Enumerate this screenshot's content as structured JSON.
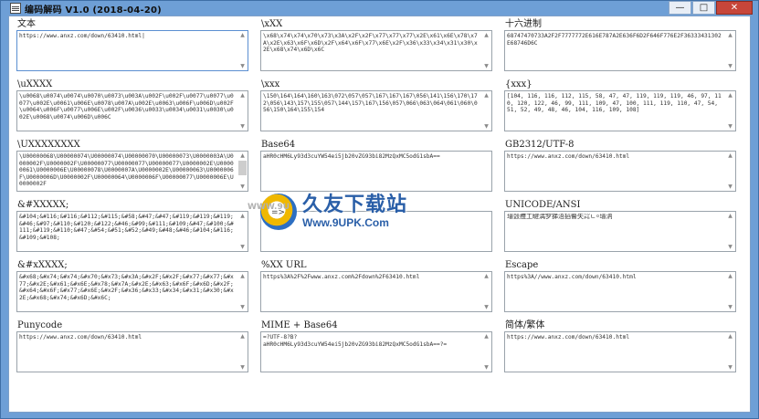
{
  "window": {
    "title": "编码解码 V1.0  (2018-04-20)",
    "buttons": {
      "minimize": "—",
      "maximize": "□",
      "close": "✕"
    }
  },
  "fields": [
    {
      "id": "text",
      "label": "文本",
      "value": "https://www.anxz.com/down/63410.html|",
      "scroll": "arrows"
    },
    {
      "id": "hex-escape",
      "label": "\\xXX",
      "value": "\\x68\\x74\\x74\\x70\\x73\\x3A\\x2F\\x2F\\x77\\x77\\x77\\x2E\\x61\\x6E\\x78\\x7A\\x2E\\x63\\x6F\\x6D\\x2F\\x64\\x6F\\x77\\x6E\\x2F\\x36\\x33\\x34\\x31\\x30\\x2E\\x68\\x74\\x6D\\x6C",
      "scroll": "arrows"
    },
    {
      "id": "hex",
      "label": "十六进制",
      "value": "68747470733A2F2F7777772E616E787A2E636F6D2F646F776E2F36333431302E68746D6C",
      "scroll": "arrows"
    },
    {
      "id": "unicode-escape",
      "label": "\\uXXXX",
      "value": "\\u0068\\u0074\\u0074\\u0070\\u0073\\u003A\\u002F\\u002F\\u0077\\u0077\\u0077\\u002E\\u0061\\u006E\\u0078\\u007A\\u002E\\u0063\\u006F\\u006D\\u002F\\u0064\\u006F\\u0077\\u006E\\u002F\\u0036\\u0033\\u0034\\u0031\\u0030\\u002E\\u0068\\u0074\\u006D\\u006C",
      "scroll": "arrows"
    },
    {
      "id": "octal-escape",
      "label": "\\xxx",
      "value": "\\150\\164\\164\\160\\163\\072\\057\\057\\167\\167\\167\\056\\141\\156\\170\\172\\056\\143\\157\\155\\057\\144\\157\\167\\156\\057\\066\\063\\064\\061\\060\\056\\150\\164\\155\\154",
      "scroll": "arrows"
    },
    {
      "id": "decimal-list",
      "label": "{xxx}",
      "value": "[104, 116, 116, 112, 115, 58, 47, 47, 119, 119, 119, 46, 97, 110, 120, 122, 46, 99, 111, 109, 47, 100, 111, 119, 110, 47, 54, 51, 52, 49, 48, 46, 104, 116, 109, 108]",
      "scroll": "arrows"
    },
    {
      "id": "unicode32-escape",
      "label": "\\UXXXXXXXX",
      "value": "\\U00000068\\U00000074\\U00000074\\U00000070\\U00000073\\U0000003A\\U0000002F\\U0000002F\\U00000077\\U00000077\\U00000077\\U0000002E\\U00000061\\U0000006E\\U00000078\\U0000007A\\U0000002E\\U00000063\\U0000006F\\U0000006D\\U0000002F\\U00000064\\U0000006F\\U00000077\\U0000006E\\U0000002F",
      "scroll": "thumb"
    },
    {
      "id": "base64",
      "label": "Base64",
      "value": "aHR0cHM6Ly93d3cuYW54ei5jb20vZG93bi82MzQxMC5odG1sbA==",
      "scroll": "none"
    },
    {
      "id": "gb2312",
      "label": "GB2312/UTF-8",
      "value": "https://www.anxz.com/down/63410.html",
      "scroll": "arrows"
    },
    {
      "id": "html-decimal",
      "label": "&#XXXXX;",
      "value": "&#104;&#116;&#116;&#112;&#115;&#58;&#47;&#47;&#119;&#119;&#119;&#46;&#97;&#110;&#120;&#122;&#46;&#99;&#111;&#109;&#47;&#100;&#111;&#119;&#110;&#47;&#54;&#51;&#52;&#49;&#48;&#46;&#104;&#116;&#109;&#108;",
      "scroll": "arrows"
    },
    {
      "id": "middle-4",
      "label": "",
      "value": "ht",
      "scroll": "none"
    },
    {
      "id": "unicode-ansi",
      "label": "UNICODE/ANSI",
      "value": "瑨瑴㩳⼯睷⹷湡穸挮浯搯睯⽮㌶ㄴ⸰瑨汭",
      "scroll": "arrows"
    },
    {
      "id": "html-hex",
      "label": "&#xXXXX;",
      "value": "&#x68;&#x74;&#x74;&#x70;&#x73;&#x3A;&#x2F;&#x2F;&#x77;&#x77;&#x77;&#x2E;&#x61;&#x6E;&#x78;&#x7A;&#x2E;&#x63;&#x6F;&#x6D;&#x2F;&#x64;&#x6F;&#x77;&#x6E;&#x2F;&#x36;&#x33;&#x34;&#x31;&#x30;&#x2E;&#x68;&#x74;&#x6D;&#x6C;",
      "scroll": "arrows"
    },
    {
      "id": "url-encode",
      "label": "%XX  URL",
      "value": "https%3A%2F%2Fwww.anxz.com%2Fdown%2F63410.html",
      "scroll": "arrows"
    },
    {
      "id": "escape",
      "label": "Escape",
      "value": "https%3A//www.anxz.com/down/63410.html",
      "scroll": "arrows"
    },
    {
      "id": "punycode",
      "label": "Punycode",
      "value": "https://www.anxz.com/down/63410.html",
      "scroll": "arrows"
    },
    {
      "id": "mime-base64",
      "label": "MIME + Base64",
      "value": "=?UTF-8?B?\naHR0cHM6Ly93d3cuYW54ei5jb20vZG93bi82MzQxMC5odG1sbA==?=",
      "scroll": "arrows"
    },
    {
      "id": "simp-trad",
      "label": "简体/繁体",
      "value": "https://www.anxz.com/down/63410.html",
      "scroll": "arrows"
    }
  ],
  "watermark": {
    "left_text": "WWW.9U",
    "chinese": "久友下载站",
    "url": "Www.9UPK.Com",
    "arrow": "=>"
  }
}
